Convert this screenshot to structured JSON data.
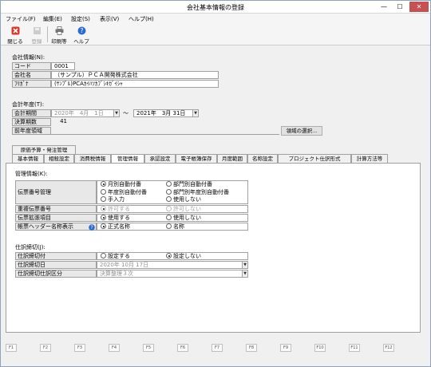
{
  "window": {
    "title": "会社基本情報の登録"
  },
  "menu": [
    "ファイル(F)",
    "編集(E)",
    "設定(S)",
    "表示(V)",
    "ヘルプ(H)"
  ],
  "toolbar": {
    "close": "閉じる",
    "register": "登録",
    "print": "印刷等",
    "help": "ヘルプ"
  },
  "company": {
    "heading": "会社情報(N):",
    "code_label": "コード",
    "code_value": "0001",
    "name_label": "会社名",
    "name_value": "（サンプル）ＰＣＡ開発株式会社",
    "kana_label": "ﾌﾘｶﾞﾅ",
    "kana_value": "(ｻﾝﾌﾟﾙ)PCAｶｲﾊﾂｶﾌﾞｼｷｶﾞｲｼｬ"
  },
  "fiscal": {
    "heading": "会計年度(T):",
    "period_label": "会計期間",
    "start": "2020年　4月　1日",
    "tilde": "～",
    "end": "2021年　3月 31日",
    "term_label": "決算期数",
    "term_value": "41",
    "prev_label": "前年度領域",
    "select_button": "領域の選択..."
  },
  "tabs_row1": [
    "原価予算・発注管理"
  ],
  "tabs_row2": [
    "基本情報",
    "相殺設定",
    "消費税情報",
    "管理情報",
    "承認設定",
    "電子帳簿保存",
    "月度範囲",
    "名称設定",
    "プロジェクト仕訳形式",
    "計算方法等"
  ],
  "mgmt": {
    "heading": "管理情報(K):",
    "voucher_mgmt_label": "伝票番号管理",
    "opt_monthly": "月別自動付番",
    "opt_dept_monthly": "部門別自動付番",
    "opt_yearly": "年度別自動付番",
    "opt_dept_yearly": "部門別年度別自動付番",
    "opt_manual": "手入力",
    "opt_unused": "使用しない",
    "dup_label": "重複伝票番号",
    "dup_allow": "許可する",
    "dup_disallow": "許可しない",
    "ext_label": "伝票拡張項目",
    "ext_use": "使用する",
    "ext_unuse": "使用しない",
    "header_label": "帳票ヘッダー名称表示",
    "hdr_formal": "正式名称",
    "hdr_name": "名称"
  },
  "close": {
    "heading": "仕訳締切(J):",
    "attach_label": "仕訳締切付",
    "set": "設定する",
    "unset": "設定しない",
    "date_label": "仕訳締切日",
    "date_value": "2020年 10月 17日",
    "class_label": "仕訳締切仕訳区分",
    "class_value": "決算整理３次"
  },
  "fkeys": [
    "F1",
    "F2",
    "F3",
    "F4",
    "F5",
    "F6",
    "F7",
    "F8",
    "F9",
    "F10",
    "F11",
    "F12"
  ]
}
